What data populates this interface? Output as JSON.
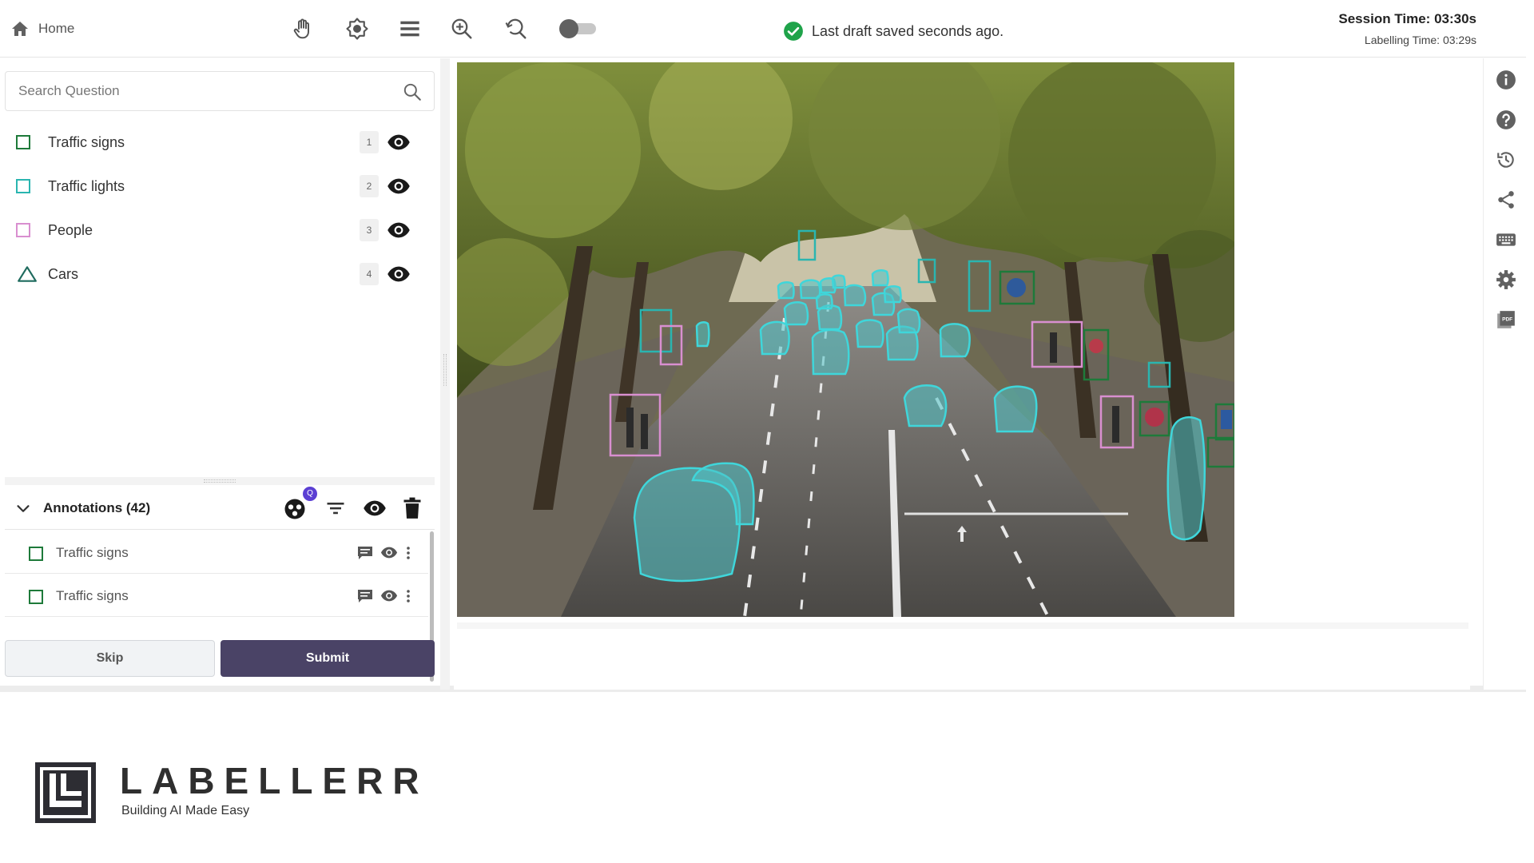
{
  "topbar": {
    "home_label": "Home",
    "tools": [
      "hand-pan-icon",
      "brightness-icon",
      "layers-menu-icon",
      "zoom-in-icon",
      "zoom-reset-icon"
    ],
    "save_status": "Last draft saved seconds ago.",
    "session_time": "Session Time: 03:30s",
    "labelling_time": "Labelling Time: 03:29s"
  },
  "search": {
    "placeholder": "Search Question"
  },
  "classes": [
    {
      "name": "Traffic signs",
      "key": "1",
      "shape": "box",
      "color": "#1e7a3a"
    },
    {
      "name": "Traffic lights",
      "key": "2",
      "shape": "box",
      "color": "#2ab5b0"
    },
    {
      "name": "People",
      "key": "3",
      "shape": "box",
      "color": "#d98fd0"
    },
    {
      "name": "Cars",
      "key": "4",
      "shape": "polygon",
      "color": "#1f6b5e"
    }
  ],
  "annotations": {
    "title": "Annotations (42)",
    "ai_badge": "Q",
    "items": [
      {
        "name": "Traffic signs"
      },
      {
        "name": "Traffic signs"
      }
    ]
  },
  "buttons": {
    "skip": "Skip",
    "submit": "Submit"
  },
  "right_rail": [
    "info-icon",
    "help-icon",
    "history-icon",
    "share-icon",
    "keyboard-icon",
    "settings-icon",
    "pdf-icon"
  ],
  "brand": {
    "name": "LABELLERR",
    "tagline": "Building AI Made Easy"
  },
  "colors": {
    "accent": "#4a4366",
    "success": "#1fa34a",
    "traffic_signs": "#1e7a3a",
    "traffic_lights": "#2ab5b0",
    "people": "#d98fd0",
    "cars": "#4fc3c7"
  }
}
